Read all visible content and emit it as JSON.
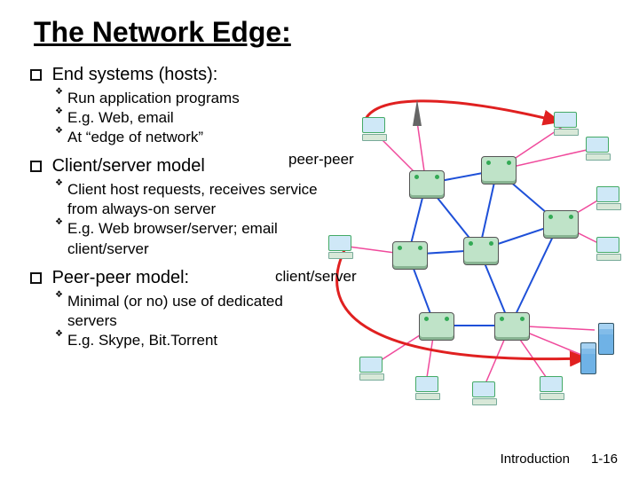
{
  "title": "The Network Edge:",
  "sections": [
    {
      "head": "End systems (hosts):",
      "items": [
        "Run application programs",
        "E.g. Web, email",
        "At “edge of network”"
      ]
    },
    {
      "head": "Client/server model",
      "items": [
        "Client host requests, receives service from always-on server",
        "E.g. Web browser/server; email client/server"
      ]
    },
    {
      "head": "Peer-peer model:",
      "items": [
        "Minimal (or no) use of dedicated servers",
        "E.g. Skype,  Bit.Torrent"
      ]
    }
  ],
  "diagram_labels": {
    "peer": "peer-peer",
    "cs": "client/server"
  },
  "footer": {
    "label": "Introduction",
    "page": "1-16"
  }
}
